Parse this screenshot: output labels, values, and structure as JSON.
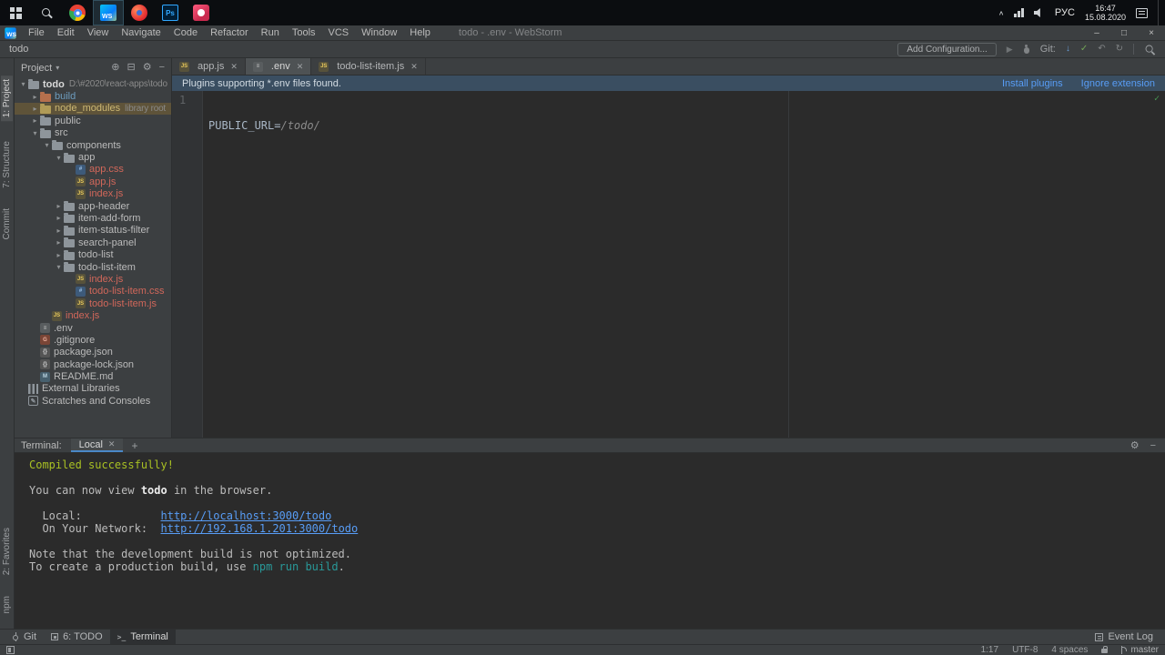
{
  "taskbar": {
    "lang": "РУС",
    "time": "16:47",
    "date": "15.08.2020"
  },
  "menubar": {
    "menus": [
      "File",
      "Edit",
      "View",
      "Navigate",
      "Code",
      "Refactor",
      "Run",
      "Tools",
      "VCS",
      "Window",
      "Help"
    ],
    "title": "todo - .env - WebStorm"
  },
  "toolbar": {
    "breadcrumb": "todo",
    "add_configuration": "Add Configuration...",
    "git_label": "Git:"
  },
  "stripes": {
    "left_top": [
      {
        "label": "1: Project",
        "active": true
      },
      {
        "label": "7: Structure",
        "active": false
      },
      {
        "label": "Commit",
        "active": false
      }
    ],
    "left_bottom": [
      {
        "label": "2: Favorites",
        "active": false
      },
      {
        "label": "npm",
        "active": false
      }
    ]
  },
  "project": {
    "header": "Project",
    "tree": [
      {
        "label": "todo",
        "meta": "D:\\#2020\\react-apps\\todo",
        "level": 0,
        "arrow": "open",
        "icon": "folder",
        "cls": "bold"
      },
      {
        "label": "build",
        "level": 1,
        "arrow": "closed",
        "icon": "folder-excluded",
        "cls": "excluded"
      },
      {
        "label": "node_modules",
        "meta": "library root",
        "level": 1,
        "arrow": "closed",
        "icon": "folder-lib",
        "cls": "lib",
        "selected": true
      },
      {
        "label": "public",
        "level": 1,
        "arrow": "closed",
        "icon": "folder"
      },
      {
        "label": "src",
        "level": 1,
        "arrow": "open",
        "icon": "folder-src"
      },
      {
        "label": "components",
        "level": 2,
        "arrow": "open",
        "icon": "folder"
      },
      {
        "label": "app",
        "level": 3,
        "arrow": "open",
        "icon": "folder"
      },
      {
        "label": "app.css",
        "level": 4,
        "icon": "css",
        "cls": "vcs"
      },
      {
        "label": "app.js",
        "level": 4,
        "icon": "js",
        "cls": "vcs"
      },
      {
        "label": "index.js",
        "level": 4,
        "icon": "js",
        "cls": "vcs"
      },
      {
        "label": "app-header",
        "level": 3,
        "arrow": "closed",
        "icon": "folder"
      },
      {
        "label": "item-add-form",
        "level": 3,
        "arrow": "closed",
        "icon": "folder"
      },
      {
        "label": "item-status-filter",
        "level": 3,
        "arrow": "closed",
        "icon": "folder"
      },
      {
        "label": "search-panel",
        "level": 3,
        "arrow": "closed",
        "icon": "folder"
      },
      {
        "label": "todo-list",
        "level": 3,
        "arrow": "closed",
        "icon": "folder"
      },
      {
        "label": "todo-list-item",
        "level": 3,
        "arrow": "open",
        "icon": "folder"
      },
      {
        "label": "index.js",
        "level": 4,
        "icon": "js",
        "cls": "vcs"
      },
      {
        "label": "todo-list-item.css",
        "level": 4,
        "icon": "css",
        "cls": "vcs"
      },
      {
        "label": "todo-list-item.js",
        "level": 4,
        "icon": "js",
        "cls": "vcs"
      },
      {
        "label": "index.js",
        "level": 2,
        "icon": "js",
        "cls": "vcs"
      },
      {
        "label": ".env",
        "level": 1,
        "icon": "env"
      },
      {
        "label": ".gitignore",
        "level": 1,
        "icon": "git"
      },
      {
        "label": "package.json",
        "level": 1,
        "icon": "json"
      },
      {
        "label": "package-lock.json",
        "level": 1,
        "icon": "json"
      },
      {
        "label": "README.md",
        "level": 1,
        "icon": "md"
      },
      {
        "label": "External Libraries",
        "level": 0,
        "icon": "extlib"
      },
      {
        "label": "Scratches and Consoles",
        "level": 0,
        "icon": "scratch"
      }
    ]
  },
  "editor": {
    "tabs": [
      {
        "label": "app.js",
        "icon": "js",
        "active": false
      },
      {
        "label": ".env",
        "icon": "env",
        "active": true
      },
      {
        "label": "todo-list-item.js",
        "icon": "js",
        "active": false
      }
    ],
    "banner": {
      "text": "Plugins supporting *.env files found.",
      "actions": [
        "Install plugins",
        "Ignore extension"
      ]
    },
    "line_number": "1",
    "code": [
      {
        "t": "PUBLIC_URL=",
        "c": "plain"
      },
      {
        "t": "/todo/",
        "c": "value"
      }
    ]
  },
  "terminal": {
    "label": "Terminal:",
    "tab": "Local",
    "lines": [
      [
        {
          "t": "Compiled successfully!",
          "c": "green"
        }
      ],
      [],
      [
        {
          "t": "You can now view ",
          "c": "plain"
        },
        {
          "t": "todo",
          "c": "bold"
        },
        {
          "t": " in the browser.",
          "c": "plain"
        }
      ],
      [],
      [
        {
          "t": "  Local:            ",
          "c": "plain"
        },
        {
          "t": "http://localhost:3000/todo",
          "c": "link"
        }
      ],
      [
        {
          "t": "  On Your Network:  ",
          "c": "plain"
        },
        {
          "t": "http://192.168.1.201:3000/todo",
          "c": "link"
        }
      ],
      [],
      [
        {
          "t": "Note that the development build is not optimized.",
          "c": "plain"
        }
      ],
      [
        {
          "t": "To create a production build, use ",
          "c": "plain"
        },
        {
          "t": "npm run build",
          "c": "cyan"
        },
        {
          "t": ".",
          "c": "plain"
        }
      ]
    ]
  },
  "tool_buttons": {
    "git": "Git",
    "todo": "6: TODO",
    "terminal": "Terminal",
    "event_log": "Event Log"
  },
  "statusbar": {
    "caret": "1:17",
    "encoding": "UTF-8",
    "indent": "4 spaces",
    "branch": "master"
  },
  "colors": {
    "accent_link": "#589df6",
    "terminal_green": "#a8c023",
    "terminal_cyan": "#299999",
    "vcs_unversioned": "#d1675a",
    "panel_bg": "#3c3f41",
    "editor_bg": "#2b2b2b",
    "banner_bg": "#3a4e61"
  }
}
